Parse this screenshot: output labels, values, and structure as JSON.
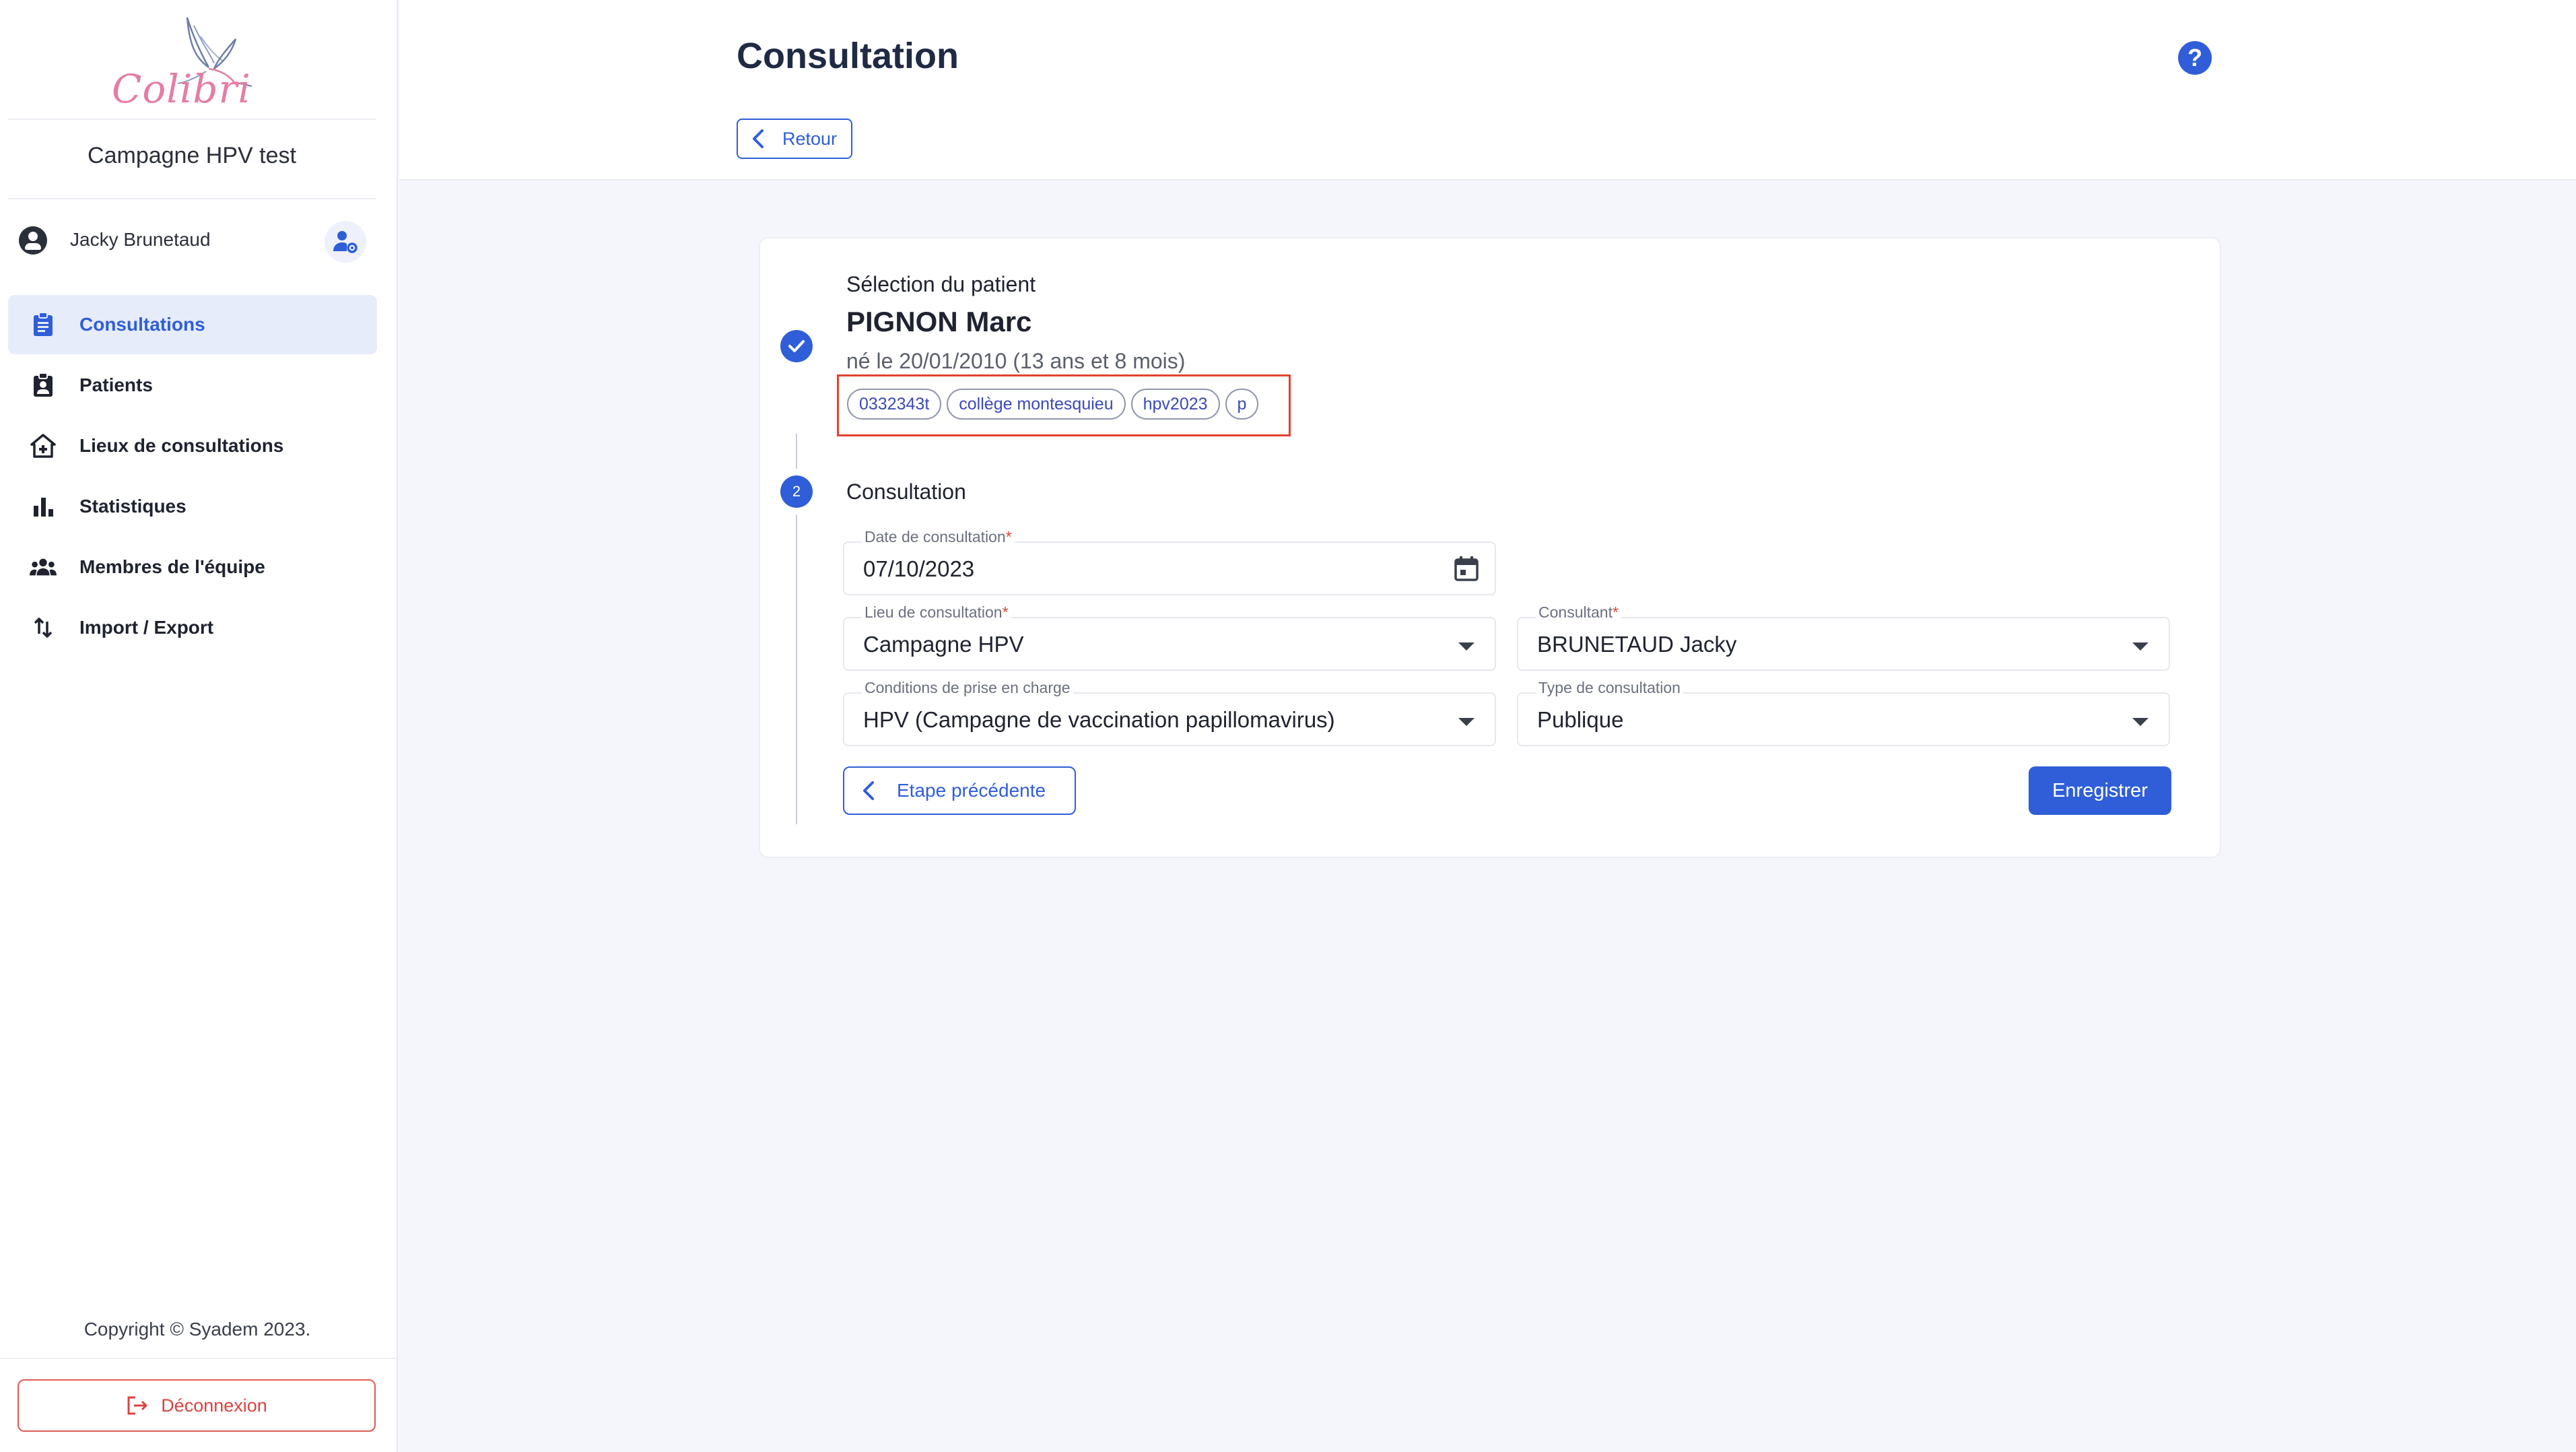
{
  "app": {
    "logo_text": "Colibri",
    "campaign": "Campagne HPV test"
  },
  "user": {
    "name": "Jacky Brunetaud"
  },
  "nav": {
    "items": [
      {
        "label": "Consultations",
        "icon": "clipboard-icon",
        "active": true
      },
      {
        "label": "Patients",
        "icon": "patient-badge-icon",
        "active": false
      },
      {
        "label": "Lieux de consultations",
        "icon": "home-plus-icon",
        "active": false
      },
      {
        "label": "Statistiques",
        "icon": "bar-chart-icon",
        "active": false
      },
      {
        "label": "Membres de l'équipe",
        "icon": "team-icon",
        "active": false
      },
      {
        "label": "Import / Export",
        "icon": "swap-vertical-icon",
        "active": false
      }
    ]
  },
  "footer": {
    "copyright": "Copyright © Syadem 2023.",
    "logout_label": "Déconnexion"
  },
  "header": {
    "title": "Consultation",
    "back_label": "Retour",
    "help": "?"
  },
  "patient_step": {
    "label": "Sélection du patient",
    "name": "PIGNON Marc",
    "birth": "né le 20/01/2010 (13 ans et 8 mois)",
    "tags": [
      "0332343t",
      "collège montesquieu",
      "hpv2023",
      "p"
    ]
  },
  "consultation_step": {
    "number": "2",
    "title": "Consultation",
    "date": {
      "label": "Date de consultation",
      "value": "07/10/2023",
      "required": "*"
    },
    "lieu": {
      "label": "Lieu de consultation",
      "value": "Campagne HPV",
      "required": "*"
    },
    "consultant": {
      "label": "Consultant",
      "value": "BRUNETAUD Jacky",
      "required": "*"
    },
    "conditions": {
      "label": "Conditions de prise en charge",
      "value": "HPV (Campagne de vaccination papillomavirus)"
    },
    "type": {
      "label": "Type de consultation",
      "value": "Publique"
    },
    "prev_label": "Etape précédente",
    "save_label": "Enregistrer"
  },
  "colors": {
    "accent": "#2f5ed8",
    "danger": "#e2432e",
    "logo": "#e57ca4"
  }
}
